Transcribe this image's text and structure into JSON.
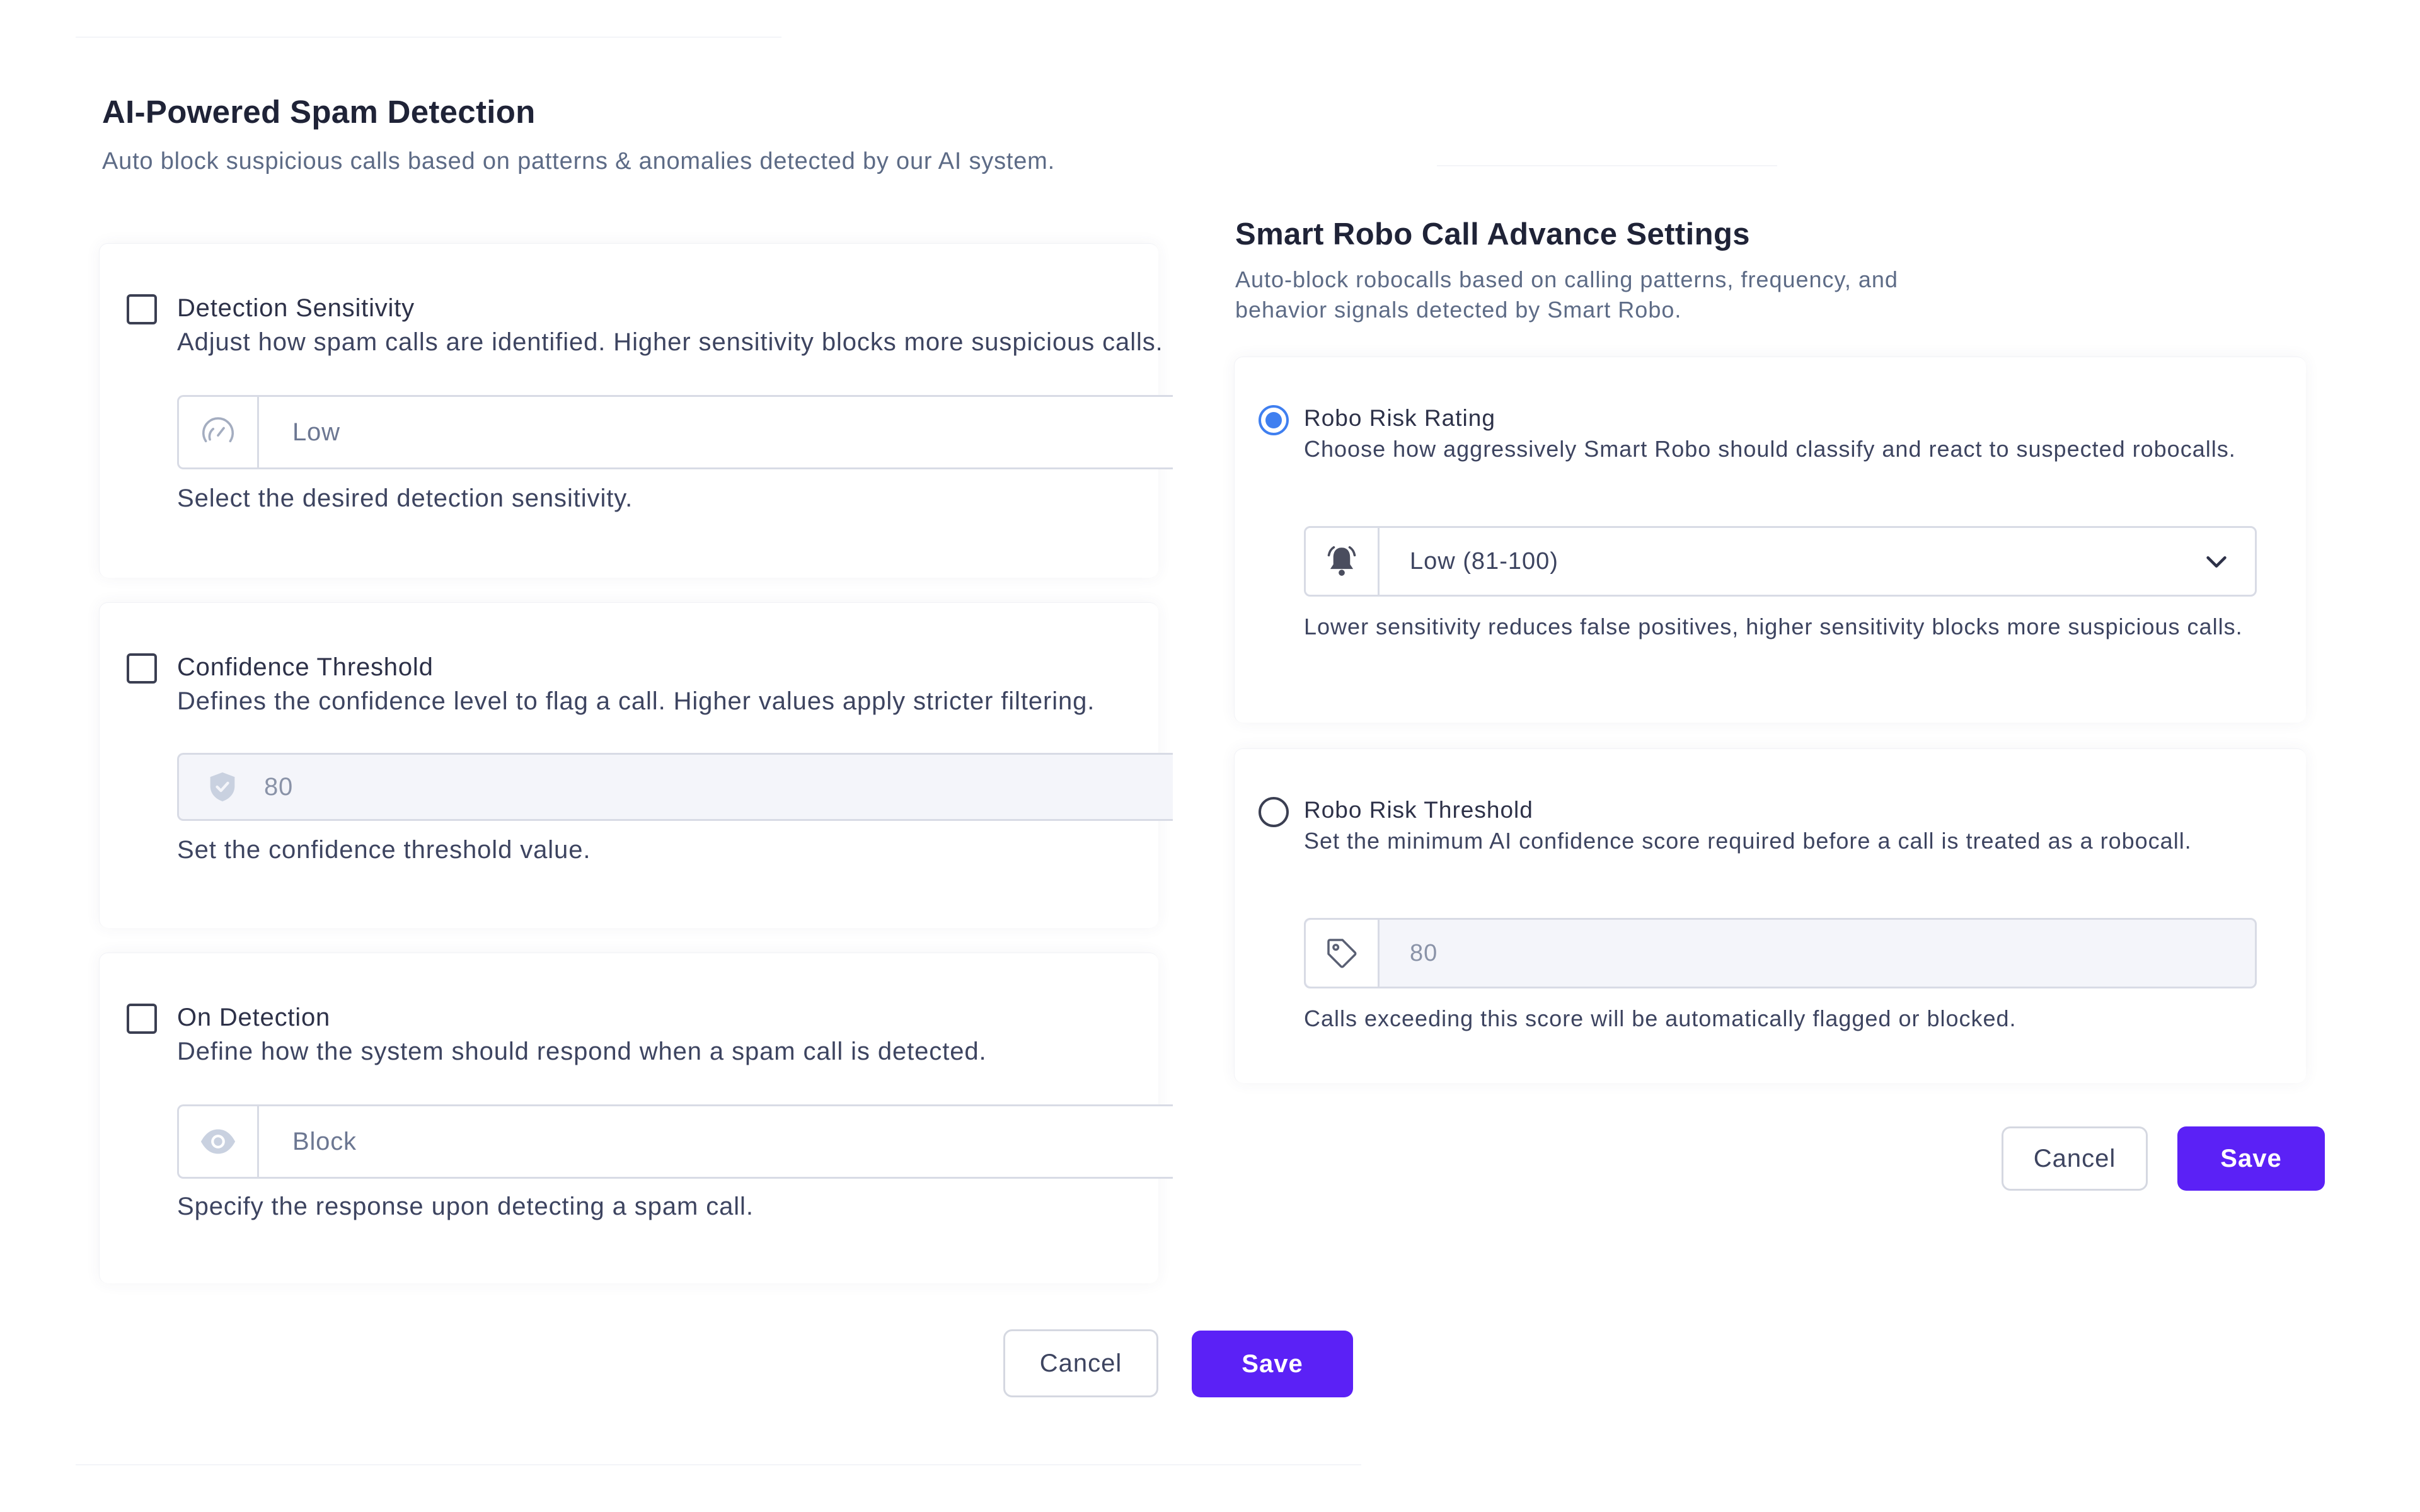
{
  "spam_detection": {
    "title": "AI-Powered Spam Detection",
    "description": "Auto block suspicious calls based on patterns & anomalies detected by our AI system.",
    "sensitivity": {
      "title": "Detection Sensitivity",
      "description": "Adjust how spam calls are identified. Higher sensitivity blocks more suspicious calls.",
      "value": "Low",
      "icon": "gauge-icon",
      "help": "Select the desired detection sensitivity.",
      "checked": false
    },
    "confidence": {
      "title": "Confidence Threshold",
      "description": "Defines the confidence level to flag a call. Higher values apply stricter filtering.",
      "value": "80",
      "icon": "shield-check-icon",
      "help": "Set the confidence threshold value.",
      "checked": false
    },
    "on_detection": {
      "title": "On Detection",
      "description": "Define how the system should respond when a spam call is detected.",
      "value": "Block",
      "icon": "eye-icon",
      "help": "Specify the response upon detecting a spam call.",
      "checked": false
    },
    "cancel_label": "Cancel",
    "save_label": "Save"
  },
  "robo_call": {
    "title": "Smart Robo Call Advance Settings",
    "description": "Auto-block robocalls based on calling patterns, frequency, and behavior signals detected by Smart Robo.",
    "risk_rating": {
      "title": "Robo Risk Rating",
      "description": "Choose how aggressively Smart Robo should classify and react to suspected robocalls.",
      "value": "Low (81-100)",
      "icon": "bell-icon",
      "help": "Lower sensitivity reduces false positives, higher sensitivity blocks more suspicious calls.",
      "selected": true
    },
    "risk_threshold": {
      "title": "Robo Risk Threshold",
      "description": "Set the minimum AI confidence score required before a call is treated as a robocall.",
      "value": "80",
      "icon": "tag-icon",
      "help": "Calls exceeding this score will be automatically flagged or blocked.",
      "selected": false
    },
    "cancel_label": "Cancel",
    "save_label": "Save"
  },
  "colors": {
    "primary": "#5b21f6",
    "radio_active": "#3f7ff0",
    "text": "#2d3148",
    "muted": "#5d6b86"
  }
}
